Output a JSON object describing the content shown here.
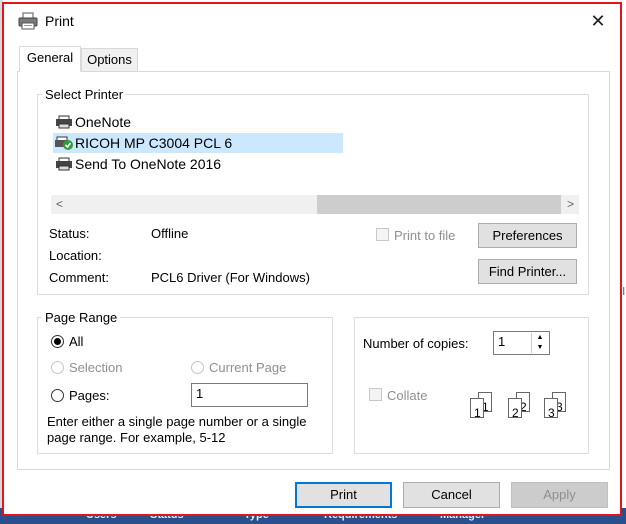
{
  "background": {
    "strip_items": [
      "Users",
      "Status",
      "Type",
      "Requirements",
      "Manager"
    ],
    "right_edge_text": [
      "ail",
      "al"
    ]
  },
  "window": {
    "title": "Print",
    "close_glyph": "✕"
  },
  "tabs": [
    {
      "label": "General",
      "active": true
    },
    {
      "label": "Options",
      "active": false
    }
  ],
  "select_printer": {
    "group_label": "Select Printer",
    "printers": [
      {
        "name": "OneNote",
        "selected": false
      },
      {
        "name": "RICOH MP C3004 PCL 6",
        "selected": true
      },
      {
        "name": "Send To OneNote 2016",
        "selected": false
      }
    ],
    "scroll_left": "<",
    "scroll_right": ">",
    "status_label": "Status:",
    "status_value": "Offline",
    "location_label": "Location:",
    "location_value": "",
    "comment_label": "Comment:",
    "comment_value": "PCL6 Driver (For Windows)",
    "print_to_file_label": "Print to file",
    "preferences_label": "Preferences",
    "find_printer_label": "Find Printer..."
  },
  "page_range": {
    "group_label": "Page Range",
    "all_label": "All",
    "selection_label": "Selection",
    "current_page_label": "Current Page",
    "pages_label": "Pages:",
    "pages_value": "1",
    "help_line1": "Enter either a single page number or a single",
    "help_line2": "page range.  For example, 5-12",
    "selected_option": "All"
  },
  "copies": {
    "number_label": "Number of copies:",
    "number_value": "1",
    "collate_label": "Collate",
    "collate_digits": [
      "1",
      "1",
      "2",
      "2",
      "3",
      "3"
    ]
  },
  "footer": {
    "print_label": "Print",
    "cancel_label": "Cancel",
    "apply_label": "Apply"
  },
  "colors": {
    "accent": "#0078d7",
    "selection": "#cce8ff",
    "highlight_border": "#e3151a"
  }
}
